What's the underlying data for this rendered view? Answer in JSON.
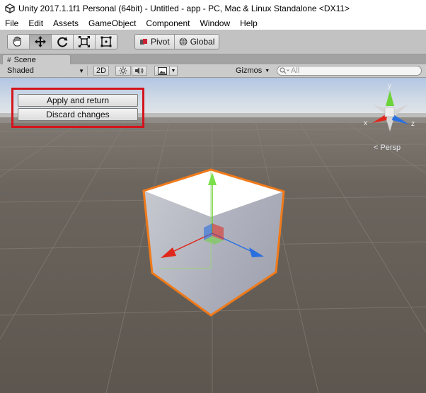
{
  "window": {
    "title": "Unity 2017.1.1f1 Personal (64bit) - Untitled - app - PC, Mac & Linux Standalone <DX11>"
  },
  "menu": [
    "File",
    "Edit",
    "Assets",
    "GameObject",
    "Component",
    "Window",
    "Help"
  ],
  "toolbar": {
    "pivot_label": "Pivot",
    "global_label": "Global"
  },
  "scene_tab": {
    "label": "Scene"
  },
  "scene_toolbar": {
    "shading_mode": "Shaded",
    "mode_2d": "2D",
    "gizmos_label": "Gizmos",
    "search_placeholder": "All"
  },
  "overlay": {
    "apply_label": "Apply and return",
    "discard_label": "Discard changes"
  },
  "gizmo": {
    "y_label": "y",
    "x_label": "x",
    "z_label": "z",
    "persp_label": "Persp"
  },
  "colors": {
    "highlight_border": "#d4141c",
    "selection_outline": "#f07a1a",
    "axis_x": "#e0271b",
    "axis_y": "#6dd33a",
    "axis_z": "#2a6fe0",
    "sky": "#b7cbe6",
    "ground": "#5d574f"
  }
}
